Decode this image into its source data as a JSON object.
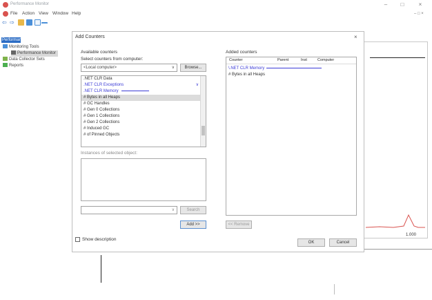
{
  "window": {
    "title": "Performance Monitor"
  },
  "menu": [
    "File",
    "Action",
    "View",
    "Window",
    "Help"
  ],
  "tree": [
    {
      "label": "Performance",
      "indent": 0
    },
    {
      "label": "Monitoring Tools",
      "indent": 1
    },
    {
      "label": "Performance Monitor",
      "indent": 2
    },
    {
      "label": "Data Collector Sets",
      "indent": 1
    },
    {
      "label": "Reports",
      "indent": 1
    }
  ],
  "dialog": {
    "title": "Add Counters",
    "available_label": "Available counters",
    "select_from_label": "Select counters from computer:",
    "computer_value": "<Local computer>",
    "browse_label": "Browse...",
    "counters": [
      {
        "text": ".NET CLR Data",
        "style": "normal"
      },
      {
        "text": ".NET CLR Exceptions",
        "style": "link"
      },
      {
        "text": ".NET CLR Memory",
        "style": "link"
      },
      {
        "text": "# Bytes in all Heaps",
        "style": "normal"
      },
      {
        "text": "# GC Handles",
        "style": "normal"
      },
      {
        "text": "# Gen 0 Collections",
        "style": "normal"
      },
      {
        "text": "# Gen 1 Collections",
        "style": "normal"
      },
      {
        "text": "# Gen 2 Collections",
        "style": "normal"
      },
      {
        "text": "# Induced GC",
        "style": "normal"
      },
      {
        "text": "# of Pinned Objects",
        "style": "normal"
      }
    ],
    "instances_label": "Instances of selected object:",
    "search_label": "Search",
    "add_label": "Add >>",
    "added_label": "Added counters",
    "added_columns": [
      "Counter",
      "Parent",
      "Inst",
      "Computer"
    ],
    "added_rows": [
      {
        "text": "\\.NET CLR Memory",
        "style": "link"
      },
      {
        "text": "# Bytes in all Heaps",
        "style": "normal"
      }
    ],
    "remove_label": "<< Remove",
    "show_description_label": "Show description",
    "ok_label": "OK",
    "cancel_label": "Cancel"
  },
  "graph": {
    "value_label": "1.000"
  }
}
